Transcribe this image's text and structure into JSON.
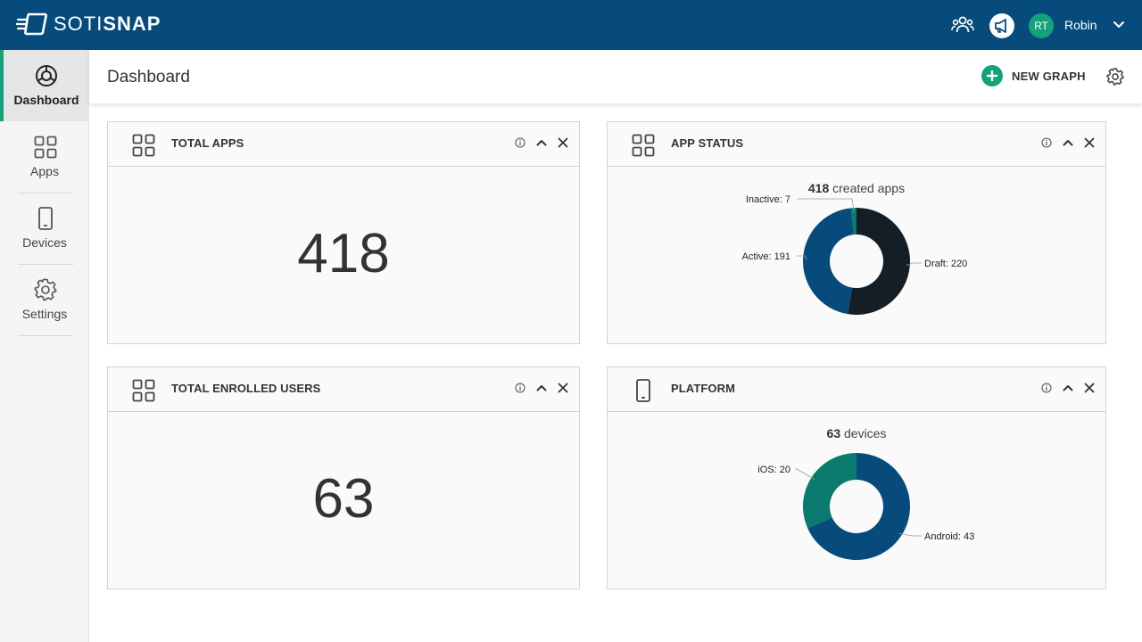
{
  "app": {
    "brand_part1": "SOTI",
    "brand_part2": "SNAP"
  },
  "topbar": {
    "user_initials": "RT",
    "user_name": "Robin",
    "avatar_color": "#12a37a",
    "bar_color": "#074b7c"
  },
  "sidebar": {
    "items": [
      {
        "label": "Dashboard",
        "icon": "dashboard-icon",
        "active": true
      },
      {
        "label": "Apps",
        "icon": "apps-grid-icon",
        "active": false
      },
      {
        "label": "Devices",
        "icon": "device-icon",
        "active": false
      },
      {
        "label": "Settings",
        "icon": "gear-icon",
        "active": false
      }
    ]
  },
  "header": {
    "title": "Dashboard",
    "new_graph_label": "NEW GRAPH"
  },
  "panels": {
    "total_apps": {
      "title": "TOTAL APPS",
      "value": "418"
    },
    "app_status": {
      "title": "APP STATUS",
      "count": "418",
      "count_suffix": " created apps"
    },
    "total_users": {
      "title": "TOTAL ENROLLED USERS",
      "value": "63"
    },
    "platform": {
      "title": "PLATFORM",
      "count": "63",
      "count_suffix": " devices"
    }
  },
  "chart_data": [
    {
      "type": "pie",
      "title": "418 created apps",
      "categories": [
        "Draft",
        "Active",
        "Inactive"
      ],
      "values": [
        220,
        191,
        7
      ],
      "labels": [
        "Draft: 220",
        "Active: 191",
        "Inactive: 7"
      ],
      "colors": [
        "#141e24",
        "#074b7c",
        "#0b7a6e"
      ]
    },
    {
      "type": "pie",
      "title": "63 devices",
      "categories": [
        "Android",
        "iOS"
      ],
      "values": [
        43,
        20
      ],
      "labels": [
        "Android: 43",
        "iOS: 20"
      ],
      "colors": [
        "#074b7c",
        "#0b7a6e"
      ]
    }
  ]
}
